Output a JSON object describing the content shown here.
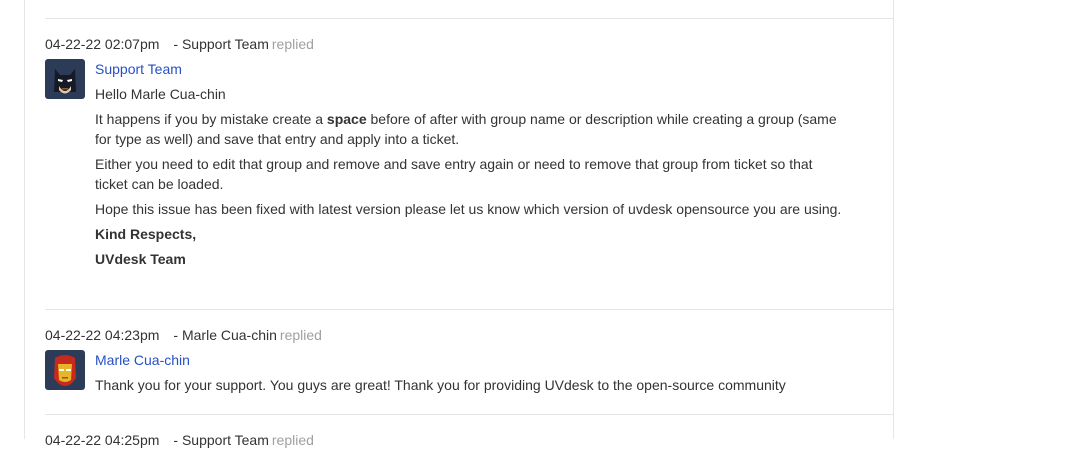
{
  "threads": [
    {
      "date": "04-22-22 02:07pm",
      "by": "- Support Team",
      "action": "replied",
      "author": "Support Team",
      "avatar_icon": "batman-avatar-icon",
      "greeting": "Hello Marle Cua-chin",
      "p1_pre": "It happens if you by mistake create a ",
      "p1_bold": "space",
      "p1_post": " before of after with group name or description while creating a group (same for type as well) and save that entry and apply into a ticket.",
      "p2": "Either you need to edit that group and remove and save entry again or need to remove that group from ticket so that ticket can be loaded.",
      "p3": "Hope this issue has been fixed with latest version please let us know which version of uvdesk opensource you are using.",
      "sign1": "Kind Respects,",
      "sign2": "UVdesk Team"
    },
    {
      "date": "04-22-22 04:23pm",
      "by": "- Marle Cua-chin",
      "action": "replied",
      "author": "Marle Cua-chin",
      "avatar_icon": "ironman-avatar-icon",
      "message": "Thank you for your support. You guys are great! Thank you for providing UVdesk to the open-source community"
    },
    {
      "date": "04-22-22 04:25pm",
      "by": "- Support Team",
      "action": "replied"
    }
  ],
  "colors": {
    "link": "#2750c4",
    "muted": "#a0a0a0",
    "divider": "#e4e4e4"
  }
}
